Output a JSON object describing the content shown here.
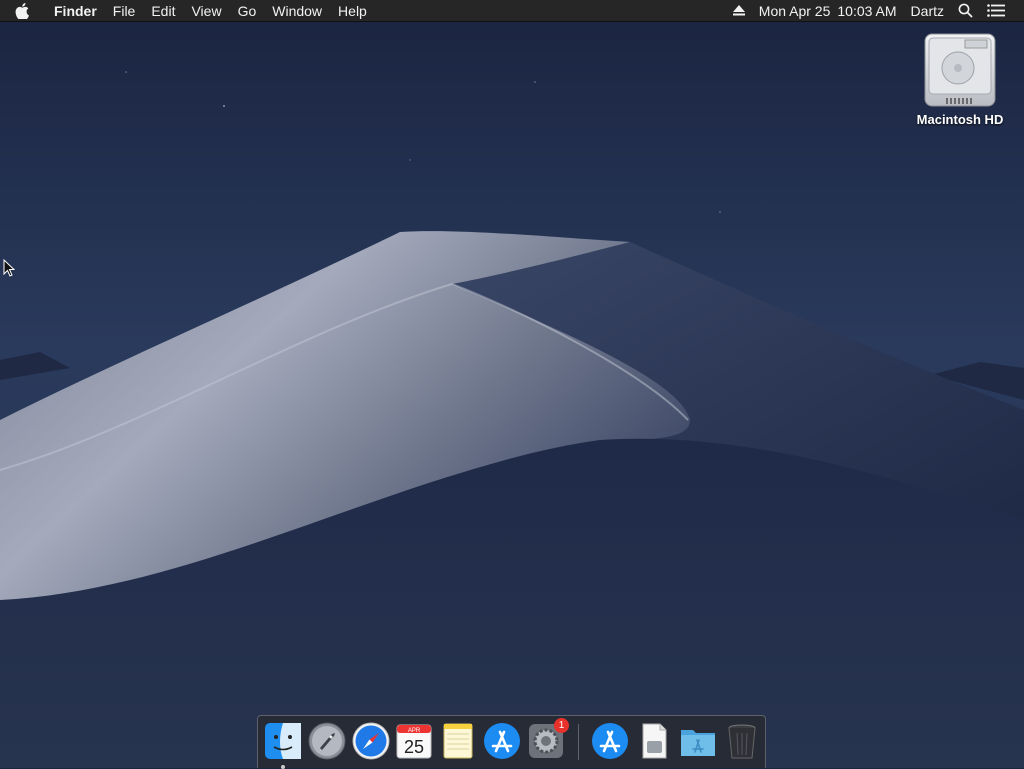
{
  "menubar": {
    "app_name": "Finder",
    "menus": [
      "File",
      "Edit",
      "View",
      "Go",
      "Window",
      "Help"
    ],
    "status": {
      "eject_icon": "eject-icon",
      "date": "Mon Apr 25",
      "time": "10:03 AM",
      "user": "Dartz",
      "spotlight_icon": "search-icon",
      "notifications_icon": "list-icon"
    }
  },
  "desktop": {
    "drive_label": "Macintosh HD"
  },
  "dock": {
    "apps": [
      {
        "name": "Finder",
        "icon": "finder-icon",
        "running": true
      },
      {
        "name": "Launchpad",
        "icon": "rocket-icon"
      },
      {
        "name": "Safari",
        "icon": "compass-icon"
      },
      {
        "name": "Calendar",
        "icon": "calendar-icon",
        "month": "APR",
        "day": "25"
      },
      {
        "name": "Notes",
        "icon": "notes-icon"
      },
      {
        "name": "App Store",
        "icon": "app-store-icon"
      },
      {
        "name": "System Preferences",
        "icon": "gear-icon",
        "badge": "1"
      },
      {
        "name": "App Store Downloads",
        "icon": "app-store-icon"
      },
      {
        "name": "Document",
        "icon": "document-icon"
      },
      {
        "name": "Applications",
        "icon": "folder-icon"
      },
      {
        "name": "Trash",
        "icon": "trash-icon"
      }
    ]
  },
  "colors": {
    "sky": "#1d2b4a",
    "dune": "#8b92a6",
    "menubar": "#262626",
    "badge": "#e8312b"
  }
}
